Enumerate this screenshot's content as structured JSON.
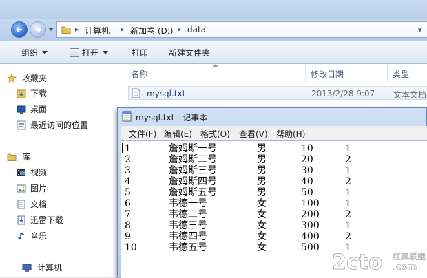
{
  "explorer": {
    "breadcrumb": [
      "计算机",
      "新加卷 (D:)",
      "data"
    ],
    "toolbar": [
      "组织",
      "打开",
      "打印",
      "新建文件夹"
    ],
    "nav": {
      "favorites": [
        "收藏夹",
        "下载",
        "桌面",
        "最近访问的位置"
      ],
      "libraries": [
        "库",
        "视频",
        "图片",
        "文档",
        "迅雷下载",
        "音乐"
      ],
      "computer": "计算机"
    },
    "columns": [
      "名称",
      "修改日期",
      "类型"
    ],
    "file": {
      "name": "mysql.txt",
      "modified": "2013/2/28 9:07",
      "type": "文本文档"
    }
  },
  "notepad": {
    "title": "mysql.txt - 记事本",
    "menus": [
      "文件(F)",
      "编辑(E)",
      "格式(O)",
      "查看(V)",
      "帮助(H)"
    ],
    "rows": [
      [
        "1",
        "詹姆斯一号",
        "男",
        "10",
        "1"
      ],
      [
        "2",
        "詹姆斯二号",
        "男",
        "20",
        "2"
      ],
      [
        "3",
        "詹姆斯三号",
        "男",
        "30",
        "1"
      ],
      [
        "4",
        "詹姆斯四号",
        "男",
        "40",
        "2"
      ],
      [
        "5",
        "詹姆斯五号",
        "男",
        "50",
        "1"
      ],
      [
        "6",
        "韦德一号",
        "女",
        "100",
        "1"
      ],
      [
        "7",
        "韦德二号",
        "女",
        "200",
        "2"
      ],
      [
        "8",
        "韦德三号",
        "女",
        "300",
        "1"
      ],
      [
        "9",
        "韦德四号",
        "女",
        "400",
        "2"
      ],
      [
        "10",
        "韦德五号",
        "女",
        "500",
        "1"
      ]
    ]
  },
  "watermark": {
    "logo": "2cto",
    "domain": ".com",
    "site_name": "红黑联盟"
  }
}
